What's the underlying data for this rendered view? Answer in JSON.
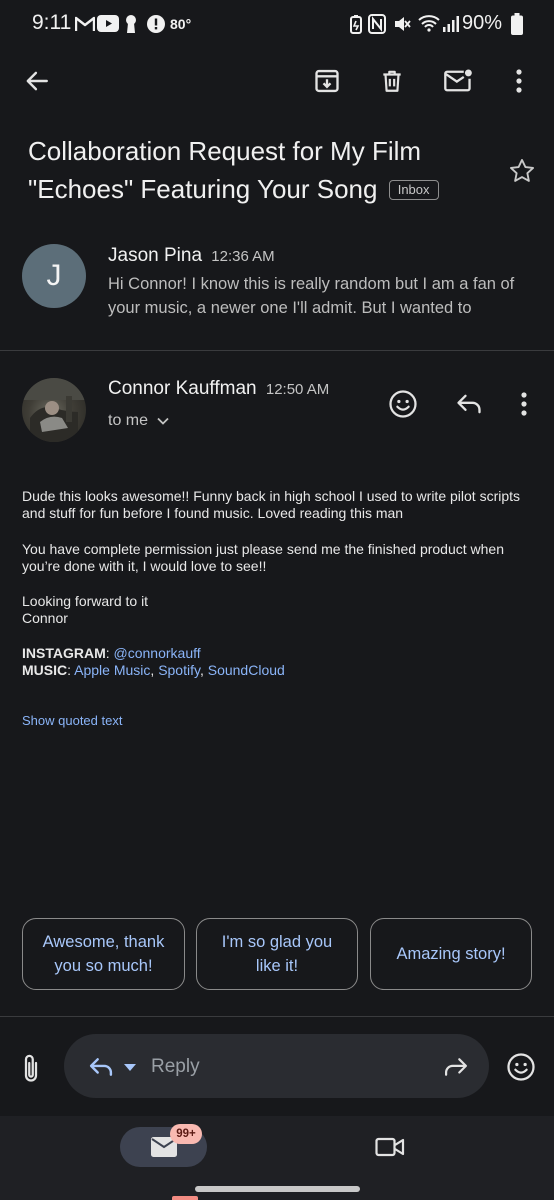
{
  "status_bar": {
    "time": "9:11",
    "temperature": "80°",
    "battery": "90%",
    "icons": [
      "gmail-icon",
      "youtube-icon",
      "keyhole-icon",
      "alert-icon",
      "battery-saver-icon",
      "nfc-icon",
      "mute-icon",
      "wifi-icon",
      "signal-icon",
      "battery-icon"
    ]
  },
  "toolbar": {
    "icons": [
      "back-arrow-icon",
      "archive-icon",
      "delete-icon",
      "mark-unread-icon",
      "more-vert-icon"
    ]
  },
  "email": {
    "subject": "Collaboration Request for My Film \"Echoes\" Featuring Your Song",
    "label": "Inbox"
  },
  "messages": [
    {
      "avatar_initial": "J",
      "sender": "Jason Pina",
      "time": "12:36 AM",
      "snippet": "Hi Connor! I know this is really random but I am a fan of your music, a newer one I'll admit. But I wanted to"
    },
    {
      "sender": "Connor Kauffman",
      "time": "12:50 AM",
      "recipient": "to me",
      "body": {
        "p1": "Dude this looks awesome!! Funny back in high school I used to write pilot scripts and stuff for fun before I found music. Loved reading this man",
        "p2": "You have complete permission just please send me the finished product when you’re done with it, I would love to see!!",
        "p3_line1": "Looking forward to it",
        "p3_line2": "Connor",
        "instagram_label": "INSTAGRAM",
        "instagram_handle": "@connorkauff",
        "music_label": "MUSIC",
        "music_links": [
          "Apple Music",
          "Spotify",
          "SoundCloud"
        ]
      },
      "show_quoted": "Show quoted text"
    }
  ],
  "smart_replies": [
    {
      "line1": "Awesome, thank",
      "line2": "you so much!"
    },
    {
      "line1": "I'm so glad you",
      "line2": "like it!"
    },
    {
      "line1": "Amazing story!",
      "line2": ""
    }
  ],
  "reply_bar": {
    "placeholder": "Reply"
  },
  "bottom_nav": {
    "mail_badge": "99+"
  },
  "colors": {
    "background": "#17181b",
    "link": "#8ab4f8",
    "chip_text": "#a8c7fa",
    "badge": "#f9b9b1",
    "avatar_j": "#5c6e79"
  }
}
